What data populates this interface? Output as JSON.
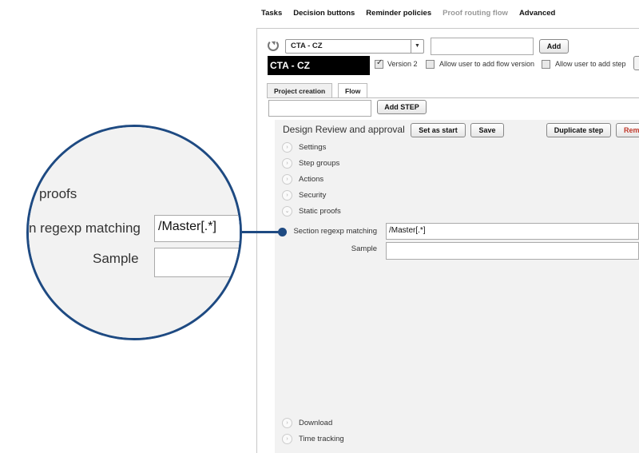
{
  "nav": {
    "items": [
      {
        "label": "Tasks",
        "disabled": false
      },
      {
        "label": "Decision buttons",
        "disabled": false
      },
      {
        "label": "Reminder policies",
        "disabled": false
      },
      {
        "label": "Proof routing flow",
        "disabled": true
      },
      {
        "label": "Advanced",
        "disabled": false
      }
    ]
  },
  "flow": {
    "selected": "CTA - CZ",
    "name_value": "",
    "add_label": "Add",
    "current_name": "CTA - CZ",
    "version_label": "Version 2",
    "version_checked": true,
    "allow_flow_version_label": "Allow user to add flow version",
    "allow_flow_version_checked": false,
    "allow_step_label": "Allow user to add step",
    "allow_step_checked": false
  },
  "tabs": [
    {
      "label": "Project creation",
      "active": false
    },
    {
      "label": "Flow",
      "active": true
    }
  ],
  "step_toolbar": {
    "step_input_value": "",
    "add_step_label": "Add STEP"
  },
  "step": {
    "title": "Design Review and approval",
    "set_as_start_label": "Set as start",
    "save_label": "Save",
    "duplicate_label": "Duplicate step",
    "remove_label": "Rem",
    "sections": [
      {
        "label": "Settings",
        "expanded": false
      },
      {
        "label": "Step groups",
        "expanded": false
      },
      {
        "label": "Actions",
        "expanded": false
      },
      {
        "label": "Security",
        "expanded": false
      },
      {
        "label": "Static proofs",
        "expanded": true
      }
    ],
    "static_proofs": {
      "regexp_label": "Section regexp matching",
      "regexp_value": "/Master[.*]",
      "sample_label": "Sample",
      "sample_value": ""
    },
    "bottom_sections": [
      {
        "label": "Download",
        "expanded": false
      },
      {
        "label": "Time tracking",
        "expanded": false
      }
    ]
  },
  "magnifier": {
    "proofs_text": "proofs",
    "regexp_text": "n regexp matching",
    "regexp_value": "/Master[.*]",
    "sample_text": "Sample"
  },
  "colors": {
    "accent": "#1e4a82",
    "remove": "#c0392b"
  }
}
